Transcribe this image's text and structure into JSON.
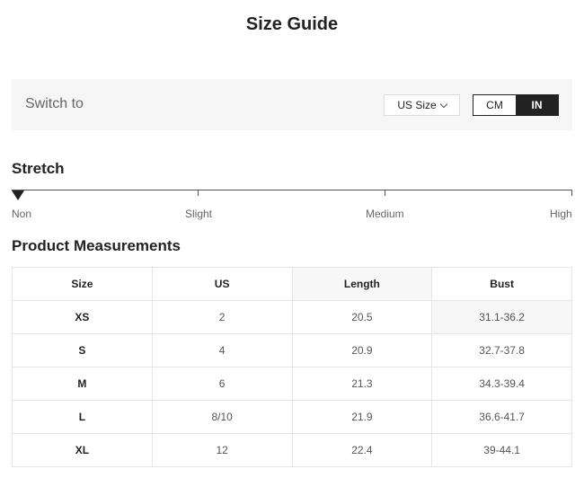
{
  "title": "Size Guide",
  "switch_bar": {
    "label": "Switch to",
    "size_select": {
      "value": "US Size",
      "icon": "chevron-down-icon"
    },
    "unit_toggle": {
      "options": [
        "CM",
        "IN"
      ],
      "selected": "IN"
    }
  },
  "stretch": {
    "title": "Stretch",
    "levels": [
      "Non",
      "Slight",
      "Medium",
      "High"
    ],
    "current": "Non"
  },
  "measurements": {
    "title": "Product Measurements",
    "columns": [
      "Size",
      "US",
      "Length",
      "Bust"
    ],
    "rows": [
      [
        "XS",
        "2",
        "20.5",
        "31.1-36.2"
      ],
      [
        "S",
        "4",
        "20.9",
        "32.7-37.8"
      ],
      [
        "M",
        "6",
        "21.3",
        "34.3-39.4"
      ],
      [
        "L",
        "8/10",
        "21.9",
        "36.6-41.7"
      ],
      [
        "XL",
        "12",
        "22.4",
        "39-44.1"
      ]
    ]
  },
  "colors": {
    "bar_background": "#f6f6f6",
    "toggle_active": "#222222",
    "text_muted": "#666666"
  }
}
